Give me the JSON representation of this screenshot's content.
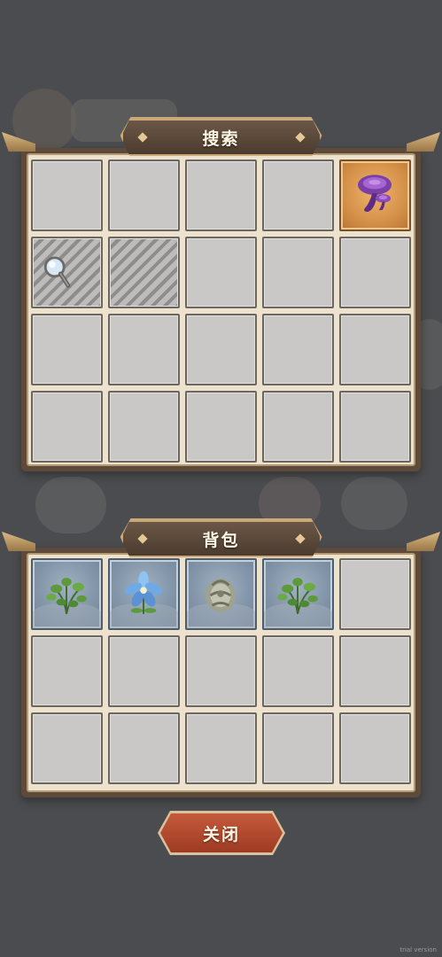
{
  "search_panel": {
    "title": "搜索",
    "rows": 4,
    "cols": 5,
    "items": [
      {
        "row": 0,
        "col": 4,
        "icon": "purple-lingzhi-mushroom-icon",
        "frame": "orange"
      },
      {
        "row": 1,
        "col": 0,
        "icon": "magnifying-glass-icon",
        "state": "searching"
      },
      {
        "row": 1,
        "col": 1,
        "state": "searching"
      }
    ]
  },
  "bag_panel": {
    "title": "背包",
    "rows": 3,
    "cols": 5,
    "items": [
      {
        "row": 0,
        "col": 0,
        "icon": "green-herb-icon",
        "frame": "blue"
      },
      {
        "row": 0,
        "col": 1,
        "icon": "blue-flower-icon",
        "frame": "blue"
      },
      {
        "row": 0,
        "col": 2,
        "icon": "grey-stone-bug-icon",
        "frame": "blue"
      },
      {
        "row": 0,
        "col": 3,
        "icon": "green-herb-icon",
        "frame": "blue"
      }
    ]
  },
  "close_button": {
    "label": "关闭"
  },
  "watermark": "trial version",
  "colors": {
    "panel_frame": "#5d4a3b",
    "panel_fill": "#ece2ce",
    "slot_empty": "#c9c8c6",
    "slot_orange": "#cf8b45",
    "slot_blue": "#7b8ea2",
    "button_red": "#b14a2e",
    "overlay": "#4a4c4f"
  }
}
